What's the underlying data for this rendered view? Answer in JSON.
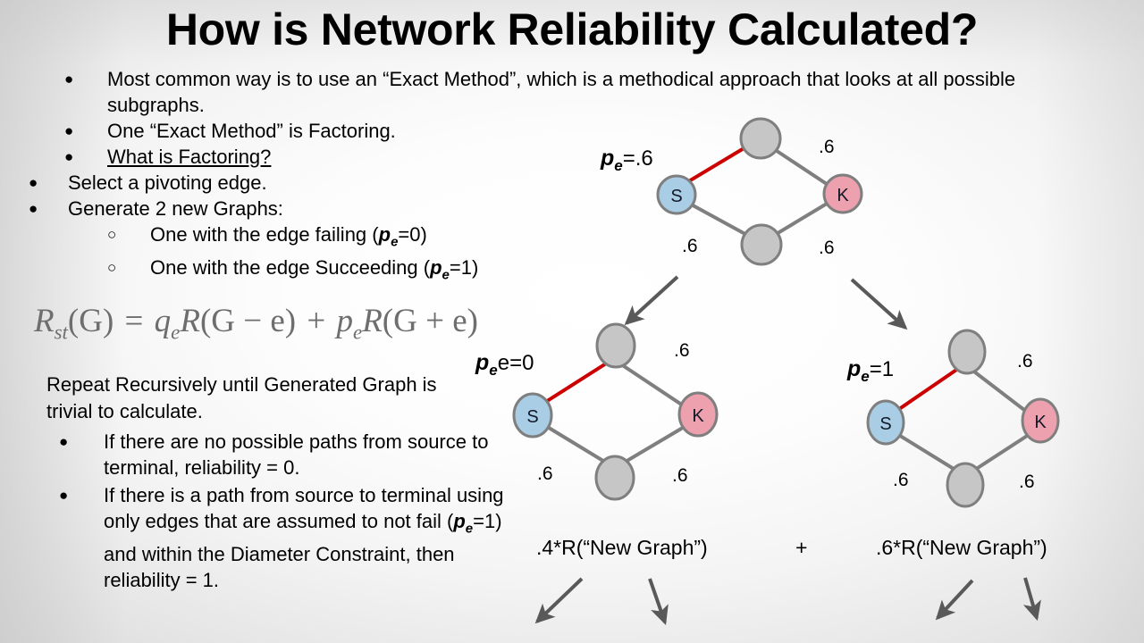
{
  "title": "How is Network Reliability Calculated?",
  "bullets_top": [
    {
      "level": 1,
      "marker": "filled",
      "text": "Most common way is to use an “Exact Method”, which is a methodical approach that looks at all possible subgraphs."
    },
    {
      "level": 1,
      "marker": "filled",
      "text": "One “Exact Method” is Factoring."
    },
    {
      "level": 1,
      "marker": "filled",
      "text": "What is Factoring?",
      "underline": true
    },
    {
      "level": 0,
      "marker": "filled",
      "text": "Select a pivoting edge."
    },
    {
      "level": 0,
      "marker": "filled",
      "text": "Generate 2 new Graphs:"
    },
    {
      "level": 2,
      "marker": "hollow",
      "text": "One with the edge failing (",
      "math_p": "p",
      "math_sub": "e",
      "text_after": "=0)"
    },
    {
      "level": 2,
      "marker": "hollow",
      "text": "One with the edge Succeeding (",
      "math_p": "p",
      "math_sub": "e",
      "text_after": "=1)"
    }
  ],
  "formula": {
    "lhs_r": "R",
    "lhs_sub": "st",
    "lhs_arg": "(G)",
    "equals": "=",
    "term1_q": "q",
    "term1_sub": "e",
    "term1_r": "R",
    "term1_arg": "(G − e)",
    "plus": "+",
    "term2_p": "p",
    "term2_sub": "e",
    "term2_r": "R",
    "term2_arg": "(G + e)",
    "plain": "R_st(G) = q_e R(G - e) + p_e R(G + e)"
  },
  "repeat_text": "Repeat Recursively until Generated Graph is trivial to calculate.",
  "bullets_bottom": [
    {
      "marker": "filled",
      "text": "If there are no possible paths from source to terminal, reliability = 0."
    },
    {
      "marker": "filled",
      "pre": "If there is a path from source to terminal using only edges that are assumed to not fail (",
      "math_p": "p",
      "math_sub": "e",
      "post": "=1) and within the Diameter Constraint, then reliability = 1."
    }
  ],
  "colors": {
    "source_node": "#a8cde5",
    "terminal_node": "#eda0ad",
    "plain_node": "#c6c6c6",
    "node_border": "#7f7f7f",
    "edge": "#7f7f7f",
    "pivot_edge": "#cc0000",
    "arrow": "#595959",
    "formula_text": "#6e6e6e",
    "text": "#000000"
  },
  "graphs": [
    {
      "id": "graph-top",
      "pe_label_p": "p",
      "pe_label_sub": "e",
      "pe_label_rest": "=.6",
      "source_label": "S",
      "terminal_label": "K",
      "edge_labels": {
        "top_right": ".6",
        "bottom_left": ".6",
        "bottom_right": ".6"
      }
    },
    {
      "id": "graph-fail",
      "pe_label_p": "p",
      "pe_label_sub": "e",
      "pe_label_rest": "e=0",
      "source_label": "S",
      "terminal_label": "K",
      "edge_labels": {
        "top_right": ".6",
        "bottom_left": ".6",
        "bottom_right": ".6"
      }
    },
    {
      "id": "graph-succeed",
      "pe_label_p": "p",
      "pe_label_sub": "e",
      "pe_label_rest": "=1",
      "source_label": "S",
      "terminal_label": "K",
      "edge_labels": {
        "top_right": ".6",
        "bottom_left": ".6",
        "bottom_right": ".6"
      }
    }
  ],
  "bottom_equation": {
    "left": ".4*R(“New Graph”)",
    "operator": "+",
    "right": ".6*R(“New Graph”)"
  }
}
